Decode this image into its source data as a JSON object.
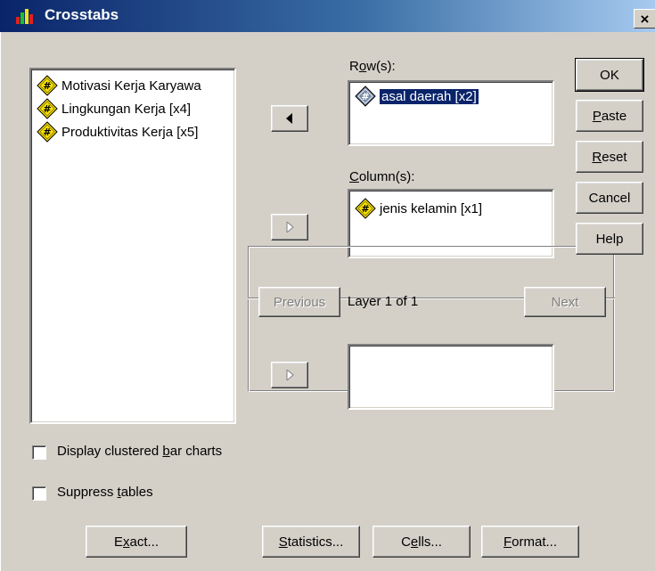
{
  "window": {
    "title": "Crosstabs",
    "close_glyph": "×"
  },
  "source_list": {
    "items": [
      {
        "label": "Motivasi Kerja Karyawa",
        "icon": "scale-variable-icon"
      },
      {
        "label": "Lingkungan Kerja [x4]",
        "icon": "scale-variable-icon"
      },
      {
        "label": "Produktivitas Kerja [x5]",
        "icon": "scale-variable-icon"
      }
    ]
  },
  "rows": {
    "label_prefix": "R",
    "label_u": "o",
    "label_rest": "w(s):",
    "items": [
      {
        "label": "asal daerah [x2]",
        "icon": "nominal-variable-icon",
        "selected": true
      }
    ]
  },
  "columns": {
    "label_prefix": "",
    "label_u": "C",
    "label_rest": "olumn(s):",
    "items": [
      {
        "label": "jenis kelamin [x1]",
        "icon": "scale-variable-icon"
      }
    ]
  },
  "layer": {
    "previous_label": "Previous",
    "next_label": "Next",
    "status": "Layer 1 of 1"
  },
  "buttons": {
    "ok": "OK",
    "paste": {
      "u": "P",
      "rest": "aste"
    },
    "reset": {
      "u": "R",
      "rest": "eset"
    },
    "cancel": "Cancel",
    "help": "Help",
    "exact": {
      "pre": "E",
      "u": "x",
      "rest": "act..."
    },
    "statistics": {
      "pre": "",
      "u": "S",
      "rest": "tatistics..."
    },
    "cells": {
      "pre": "C",
      "u": "e",
      "rest": "lls..."
    },
    "format": {
      "pre": "",
      "u": "F",
      "rest": "ormat..."
    }
  },
  "options": {
    "clustered": {
      "pre": "Display clustered ",
      "u": "b",
      "rest": "ar charts",
      "checked": false
    },
    "suppress": {
      "pre": "Suppress ",
      "u": "t",
      "rest": "ables",
      "checked": false
    }
  },
  "colors": {
    "title_start": "#0a246a",
    "title_end": "#a6caf0",
    "face": "#d4d0c8",
    "selection": "#0a246a"
  }
}
